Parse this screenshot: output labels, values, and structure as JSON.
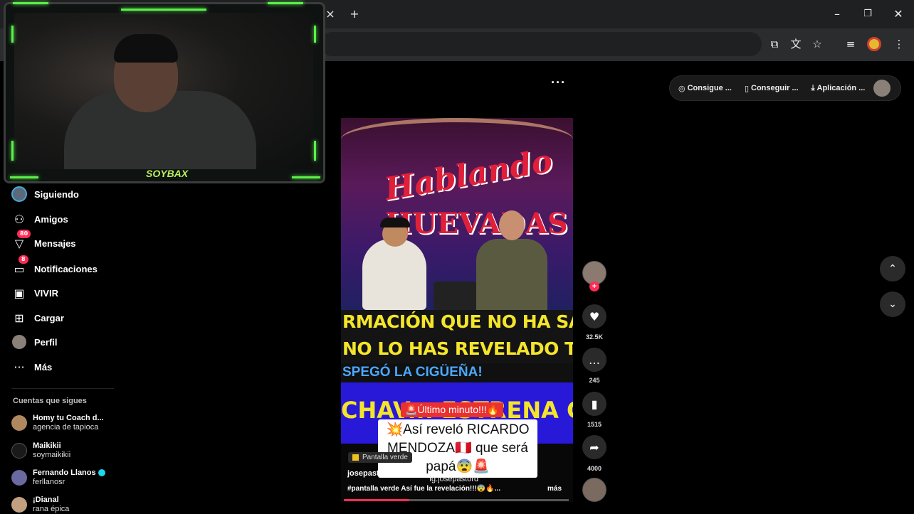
{
  "browser": {
    "tab_close": "×",
    "new_tab": "+",
    "window": {
      "minimize": "–",
      "restore": "❐",
      "close": "✕"
    },
    "toolbar_icons": [
      "cast-icon",
      "translate-icon",
      "star-icon",
      "media-icon",
      "profile-icon",
      "menu-icon"
    ]
  },
  "webcam": {
    "label": "SOYBAX",
    "accent_color": "#5cf04a"
  },
  "top_pill": {
    "items": [
      {
        "icon": "coin-icon",
        "label": "Consigue ..."
      },
      {
        "icon": "device-icon",
        "label": "Conseguir ..."
      },
      {
        "icon": "download-icon",
        "label": "Aplicación ..."
      }
    ]
  },
  "more_dots": "···",
  "sidebar": {
    "items": [
      {
        "label": "Siguiendo",
        "icon": "avatar-icon"
      },
      {
        "label": "Amigos",
        "icon": "friends-icon"
      },
      {
        "label": "Mensajes",
        "icon": "messages-icon",
        "badge": "80"
      },
      {
        "label": "Notificaciones",
        "icon": "notifications-icon",
        "badge": "8"
      },
      {
        "label": "VIVIR",
        "icon": "live-icon"
      },
      {
        "label": "Cargar",
        "icon": "upload-icon"
      },
      {
        "label": "Perfil",
        "icon": "profile-icon"
      },
      {
        "label": "Más",
        "icon": "more-icon"
      }
    ],
    "following_title": "Cuentas que sigues",
    "accounts": [
      {
        "name": "Homy tu Coach d...",
        "sub": "agencia de tapioca"
      },
      {
        "name": "Maikikii",
        "sub": "soymaikikii"
      },
      {
        "name": "Fernando Llanos",
        "sub": "ferllanosr",
        "verified": true
      },
      {
        "name": "¡Dianal",
        "sub": "rana épica"
      }
    ]
  },
  "video": {
    "logo_line1": "Hablando",
    "logo_line2": "HUEVADAS",
    "yellow_line1": "RMACIÓN QUE NO HA SALIDO",
    "yellow_line2": "NO LO HAS REVELADO TODAV",
    "cig_line": "SPEGÓ LA CIGÜEÑA!",
    "blue_line": "CHAV... ESTRENA C",
    "caption_red": "🚨Último minuto!!!🔥",
    "caption_white": "💥Así reveló RICARDO MENDOZA🇵🇪 que será papá😨🚨",
    "caption_ig": "Ig:josepastord",
    "tag": "Pantalla verde",
    "author": "josepastord",
    "description": "#pantalla verde Así fue la revelación!!!😨🔥...",
    "more": "más",
    "progress": 0.29
  },
  "rail": {
    "likes": "32.5K",
    "comments": "245",
    "saves": "1515",
    "shares": "4000"
  },
  "colors": {
    "accent": "#fe2c55",
    "background": "#000000"
  }
}
